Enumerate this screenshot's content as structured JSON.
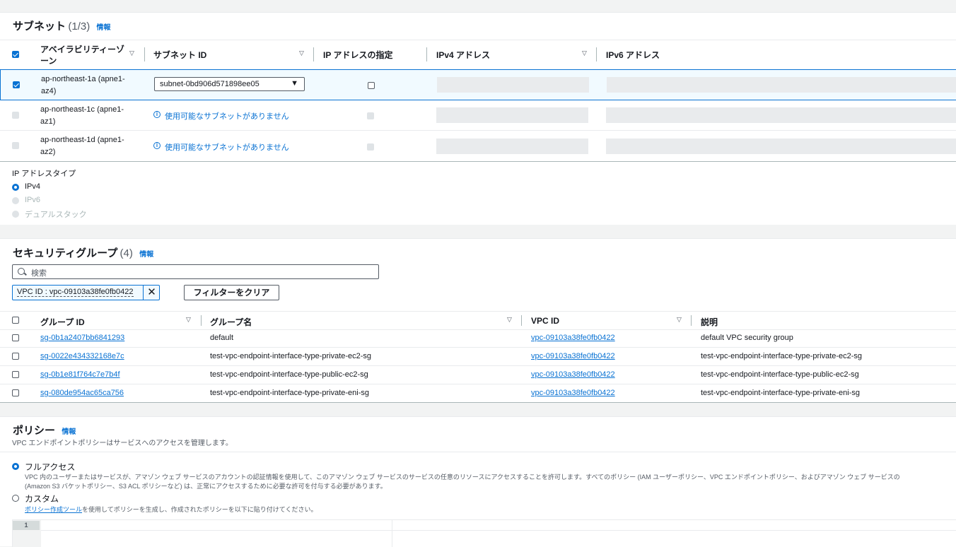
{
  "subnets": {
    "title": "サブネット",
    "count": "(1/3)",
    "info": "情報",
    "columns": [
      "アベイラビリティーゾーン",
      "サブネット ID",
      "IP アドレスの指定",
      "IPv4 アドレス",
      "IPv6 アドレス"
    ],
    "rows": [
      {
        "az_line1": "ap-northeast-1a (apne1-",
        "az_line2": "az4)",
        "subnet": "subnet-0bd906d571898ee05",
        "message": ""
      },
      {
        "az_line1": "ap-northeast-1c (apne1-",
        "az_line2": "az1)",
        "subnet": "",
        "message": "使用可能なサブネットがありません"
      },
      {
        "az_line1": "ap-northeast-1d (apne1-",
        "az_line2": "az2)",
        "subnet": "",
        "message": "使用可能なサブネットがありません"
      }
    ],
    "ip_type_label": "IP アドレスタイプ",
    "ip_types": [
      "IPv4",
      "IPv6",
      "デュアルスタック"
    ],
    "ip_type_selected": "IPv4"
  },
  "security_groups": {
    "title": "セキュリティグループ",
    "count": "(4)",
    "info": "情報",
    "search_placeholder": "検索",
    "filter_token": "VPC ID : vpc-09103a38fe0fb0422",
    "clear_filter": "フィルターをクリア",
    "columns": [
      "グループ ID",
      "グループ名",
      "VPC ID",
      "説明"
    ],
    "rows": [
      {
        "id": "sg-0b1a2407bb6841293",
        "name": "default",
        "vpc": "vpc-09103a38fe0fb0422",
        "desc": "default VPC security group"
      },
      {
        "id": "sg-0022e434332168e7c",
        "name": "test-vpc-endpoint-interface-type-private-ec2-sg",
        "vpc": "vpc-09103a38fe0fb0422",
        "desc": "test-vpc-endpoint-interface-type-private-ec2-sg"
      },
      {
        "id": "sg-0b1e81f764c7e7b4f",
        "name": "test-vpc-endpoint-interface-type-public-ec2-sg",
        "vpc": "vpc-09103a38fe0fb0422",
        "desc": "test-vpc-endpoint-interface-type-public-ec2-sg"
      },
      {
        "id": "sg-080de954ac65ca756",
        "name": "test-vpc-endpoint-interface-type-private-eni-sg",
        "vpc": "vpc-09103a38fe0fb0422",
        "desc": "test-vpc-endpoint-interface-type-private-eni-sg"
      }
    ]
  },
  "policy": {
    "title": "ポリシー",
    "info": "情報",
    "description": "VPC エンドポイントポリシーはサービスへのアクセスを管理します。",
    "full_access_label": "フルアクセス",
    "full_access_desc1": "VPC 内のユーザーまたはサービスが、アマゾン ウェブ サービスのアカウントの認証情報を使用して、このアマゾン ウェブ サービスのサービスの任意のリソースにアクセスすることを許可します。すべてのポリシー (IAM ユーザーポリシー、VPC エンドポイントポリシー、およびアマゾン ウェブ サービスの",
    "full_access_desc2": "(Amazon S3 バケットポリシー、S3 ACL ポリシーなど) は、正常にアクセスするために必要な許可を付与する必要があります。",
    "custom_label": "カスタム",
    "custom_link": "ポリシー作成ツール",
    "custom_desc": "を使用してポリシーを生成し、作成されたポリシーを以下に貼り付けてください。",
    "selected": "フルアクセス",
    "editor_line": "1"
  },
  "colors": {
    "accent": "#0972d3",
    "selected_row_bg": "#f1faff",
    "skeleton": "#e9ebed"
  }
}
